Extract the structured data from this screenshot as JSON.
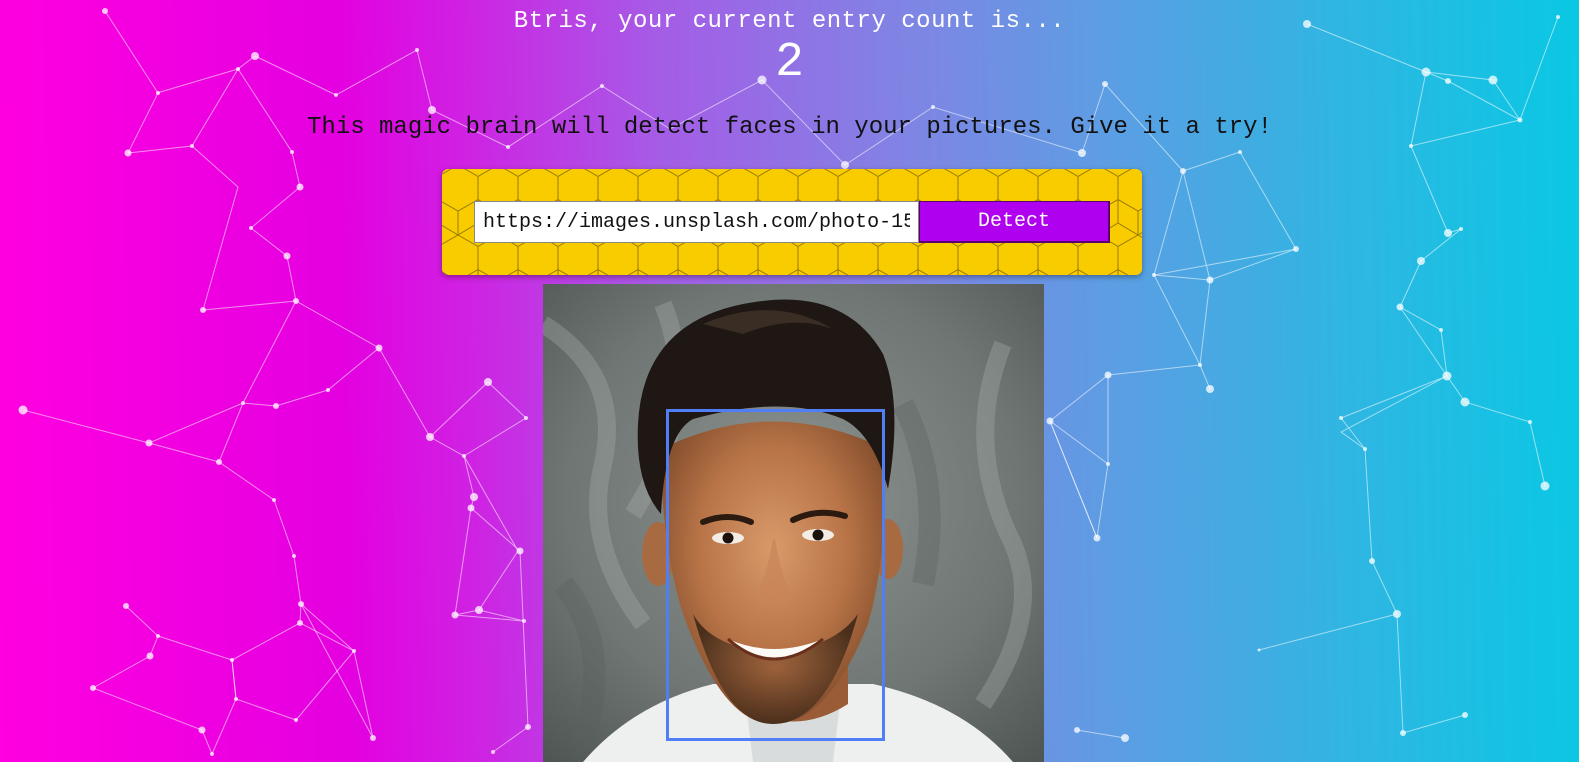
{
  "header": {
    "entry_text": "Btris, your current entry count is...",
    "entry_count": "2"
  },
  "tagline": "This magic brain will detect faces in your pictures. Give it a try!",
  "form": {
    "url_value": "https://images.unsplash.com/photo-15",
    "detect_label": "Detect"
  },
  "colors": {
    "panel_bg": "#f9cc00",
    "button_bg": "#b000f0",
    "face_box": "#4f7ef7",
    "background_left": "#ff00e0",
    "background_right": "#0ac8e4"
  },
  "image": {
    "content": "portrait-photo",
    "face_detected": true
  }
}
